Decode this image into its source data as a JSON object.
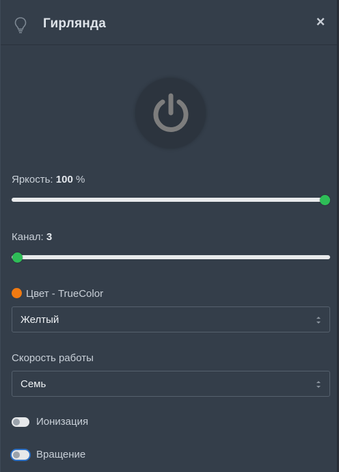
{
  "dialog": {
    "title": "Гирлянда",
    "icon": "lightbulb-icon",
    "close_label": "×"
  },
  "power": {
    "icon": "power-icon",
    "state": "off"
  },
  "brightness": {
    "label": "Яркость:",
    "value": "100",
    "unit": "%",
    "level": 100,
    "min": 0,
    "max": 100
  },
  "channel": {
    "label": "Канал:",
    "value": "3",
    "level": 3,
    "min": 3,
    "max": 100
  },
  "color": {
    "label": "Цвет - TrueColor",
    "swatch": "#f07a12",
    "selected": "Желтый"
  },
  "speed": {
    "label": "Скорость работы",
    "selected": "Семь"
  },
  "ionization": {
    "label": "Ионизация",
    "on": false
  },
  "rotation": {
    "label": "Вращение",
    "on": false
  },
  "colors": {
    "accent_green": "#2ebd57",
    "panel_bg": "#343e4a",
    "focus_ring": "#2b6fc4"
  }
}
